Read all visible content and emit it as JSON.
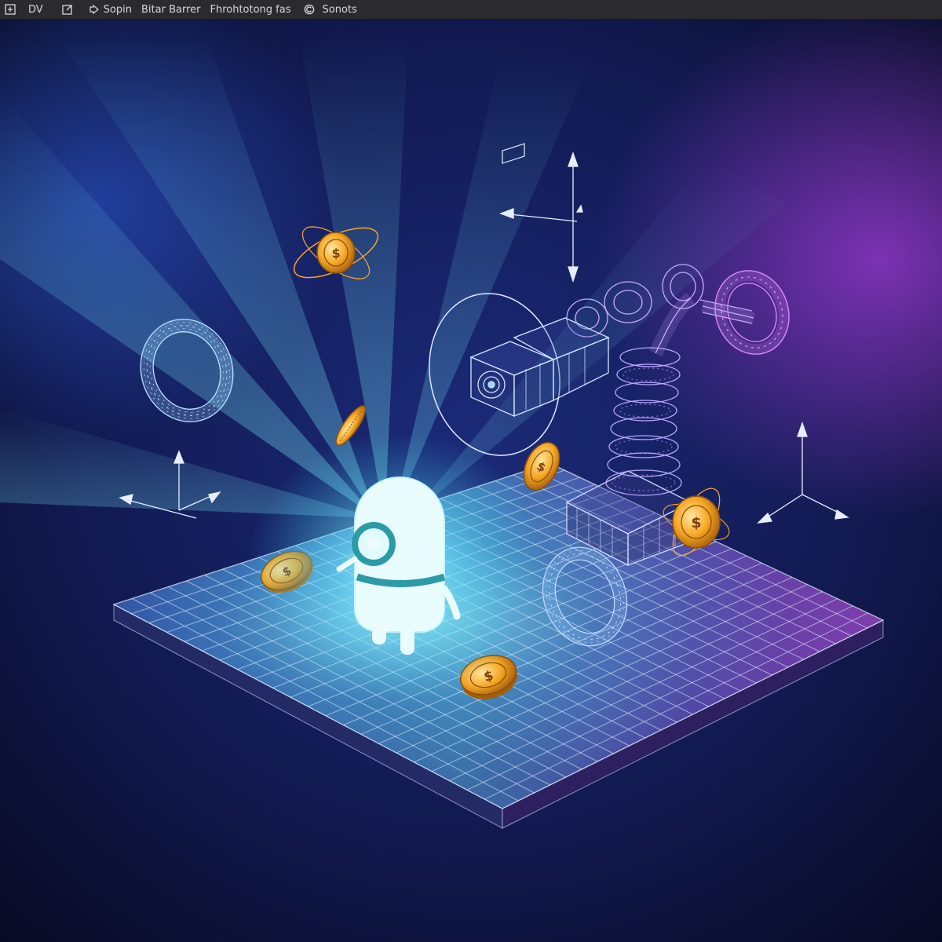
{
  "toolbar": {
    "items": [
      {
        "icon": "add-node-icon",
        "label": ""
      },
      {
        "icon": "",
        "label": "DV"
      },
      {
        "icon": "export-icon",
        "label": ""
      },
      {
        "icon": "script-icon",
        "label": "Sopin"
      },
      {
        "icon": "",
        "label": "Bitar Barrer"
      },
      {
        "icon": "",
        "label": "Fhrohtotong fas"
      },
      {
        "icon": "copyright-icon",
        "label": "Sonots"
      }
    ]
  },
  "scene": {
    "background": "#0c0f2e",
    "accent_cyan": "#7ff3ff",
    "accent_purple": "#c27bff",
    "wire_color": "#9fd2ff",
    "coin_color": "#f5a623",
    "objects": [
      "character",
      "robot-arm",
      "camera-head",
      "spring-coil",
      "torus-left",
      "torus-center",
      "coin-left",
      "coin-bottom",
      "coin-tall",
      "coin-mid",
      "orbiting-coin-top",
      "orbiting-coin-right",
      "axis-gizmo-top",
      "axis-gizmo-left",
      "axis-gizmo-right",
      "grid-floor"
    ]
  }
}
